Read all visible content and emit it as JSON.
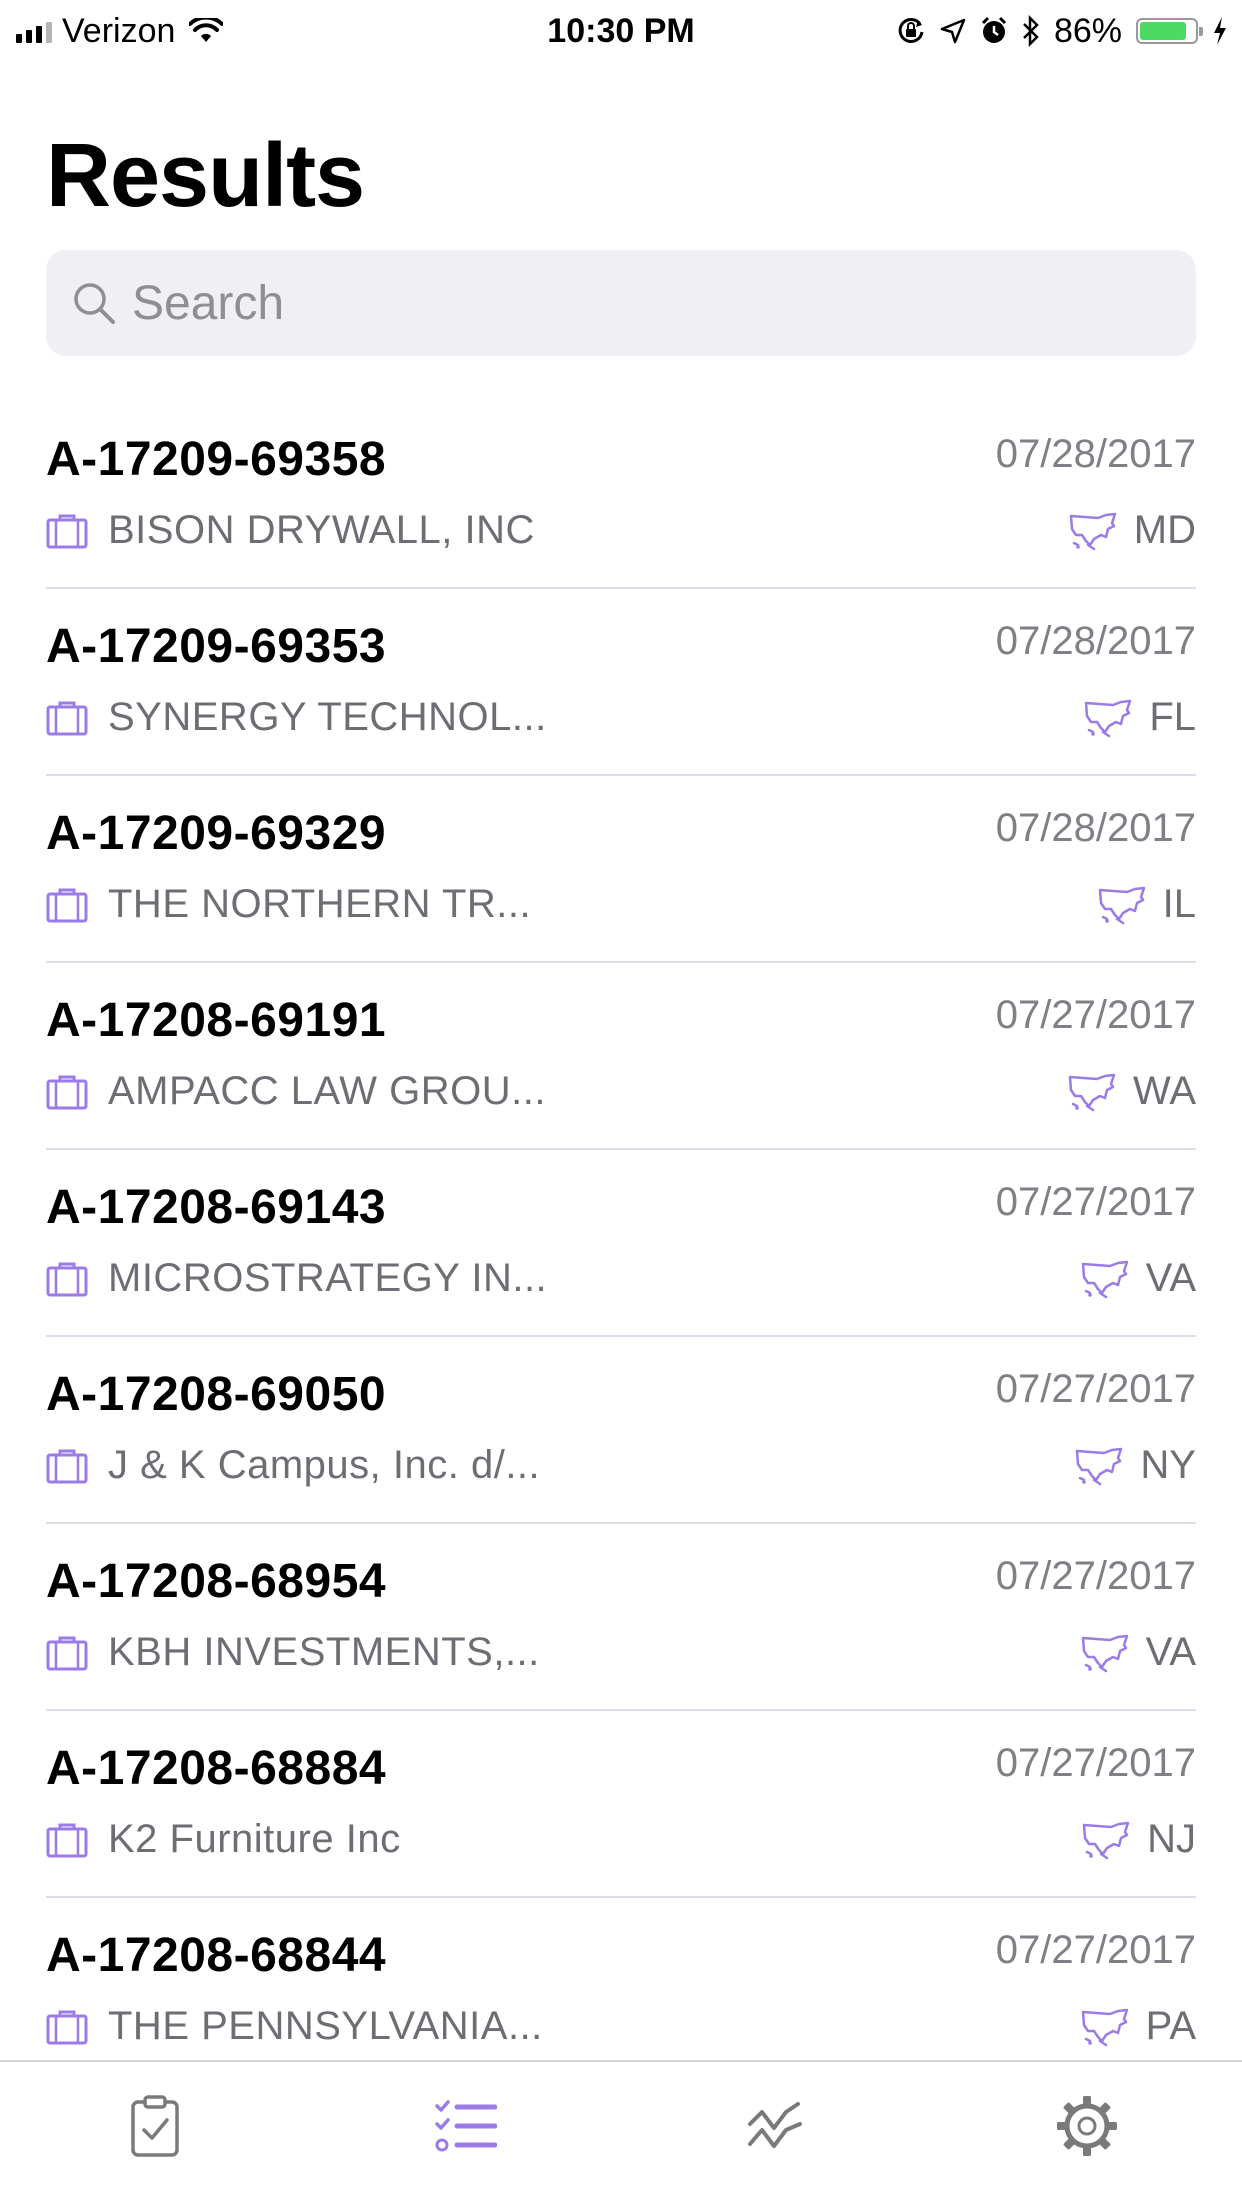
{
  "status_bar": {
    "carrier": "Verizon",
    "time": "10:30 PM",
    "battery_percent": "86%",
    "battery_level": 0.86,
    "icons": [
      "signal-icon",
      "wifi-icon",
      "orientation-lock-icon",
      "location-icon",
      "alarm-icon",
      "bluetooth-icon",
      "battery-icon",
      "charging-icon"
    ]
  },
  "page": {
    "title": "Results"
  },
  "search": {
    "placeholder": "Search",
    "value": ""
  },
  "accent_color": "#9b7be8",
  "results": [
    {
      "id": "A-17209-69358",
      "date": "07/28/2017",
      "company": "BISON DRYWALL, INC",
      "state": "MD"
    },
    {
      "id": "A-17209-69353",
      "date": "07/28/2017",
      "company": "SYNERGY TECHNOL...",
      "state": "FL"
    },
    {
      "id": "A-17209-69329",
      "date": "07/28/2017",
      "company": "THE NORTHERN TR...",
      "state": "IL"
    },
    {
      "id": "A-17208-69191",
      "date": "07/27/2017",
      "company": "AMPACC LAW GROU...",
      "state": "WA"
    },
    {
      "id": "A-17208-69143",
      "date": "07/27/2017",
      "company": "MICROSTRATEGY IN...",
      "state": "VA"
    },
    {
      "id": "A-17208-69050",
      "date": "07/27/2017",
      "company": "J & K Campus, Inc. d/...",
      "state": "NY"
    },
    {
      "id": "A-17208-68954",
      "date": "07/27/2017",
      "company": "KBH INVESTMENTS,...",
      "state": "VA"
    },
    {
      "id": "A-17208-68884",
      "date": "07/27/2017",
      "company": "K2 Furniture Inc",
      "state": "NJ"
    },
    {
      "id": "A-17208-68844",
      "date": "07/27/2017",
      "company": "THE PENNSYLVANIA...",
      "state": "PA"
    }
  ],
  "tab_bar": {
    "tabs": [
      {
        "icon": "clipboard-check-icon",
        "selected": false
      },
      {
        "icon": "list-icon",
        "selected": true
      },
      {
        "icon": "trend-chart-icon",
        "selected": false
      },
      {
        "icon": "gear-icon",
        "selected": false
      }
    ]
  }
}
